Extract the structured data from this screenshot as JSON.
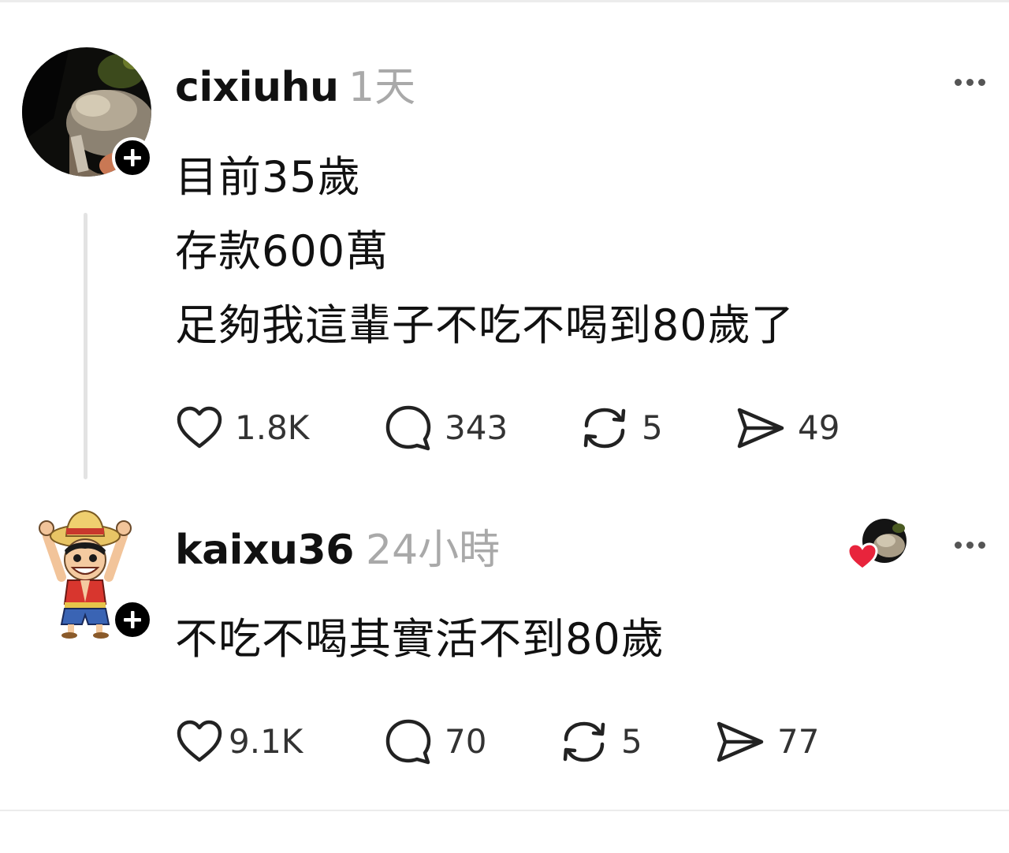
{
  "posts": [
    {
      "username": "cixiuhu",
      "timestamp": "1天",
      "body_lines": [
        "目前35歲",
        "存款600萬",
        "足夠我這輩子不吃不喝到80歲了"
      ],
      "actions": {
        "likes": "1.8K",
        "replies": "343",
        "reposts": "5",
        "shares": "49"
      },
      "icons": [
        "follow-plus-icon",
        "more-icon",
        "heart-icon",
        "comment-icon",
        "repost-icon",
        "share-icon"
      ]
    },
    {
      "username": "kaixu36",
      "timestamp": "24小時",
      "body_lines": [
        "不吃不喝其實活不到80歲"
      ],
      "actions": {
        "likes": "9.1K",
        "replies": "70",
        "reposts": "5",
        "shares": "77"
      },
      "icons": [
        "follow-plus-icon",
        "liked-by-author-heart-icon",
        "more-icon",
        "heart-icon",
        "comment-icon",
        "repost-icon",
        "share-icon"
      ]
    }
  ],
  "colors": {
    "text": "#111111",
    "muted": "#a9a9a9",
    "heart_badge": "#e8243c",
    "divider": "#ececec"
  }
}
